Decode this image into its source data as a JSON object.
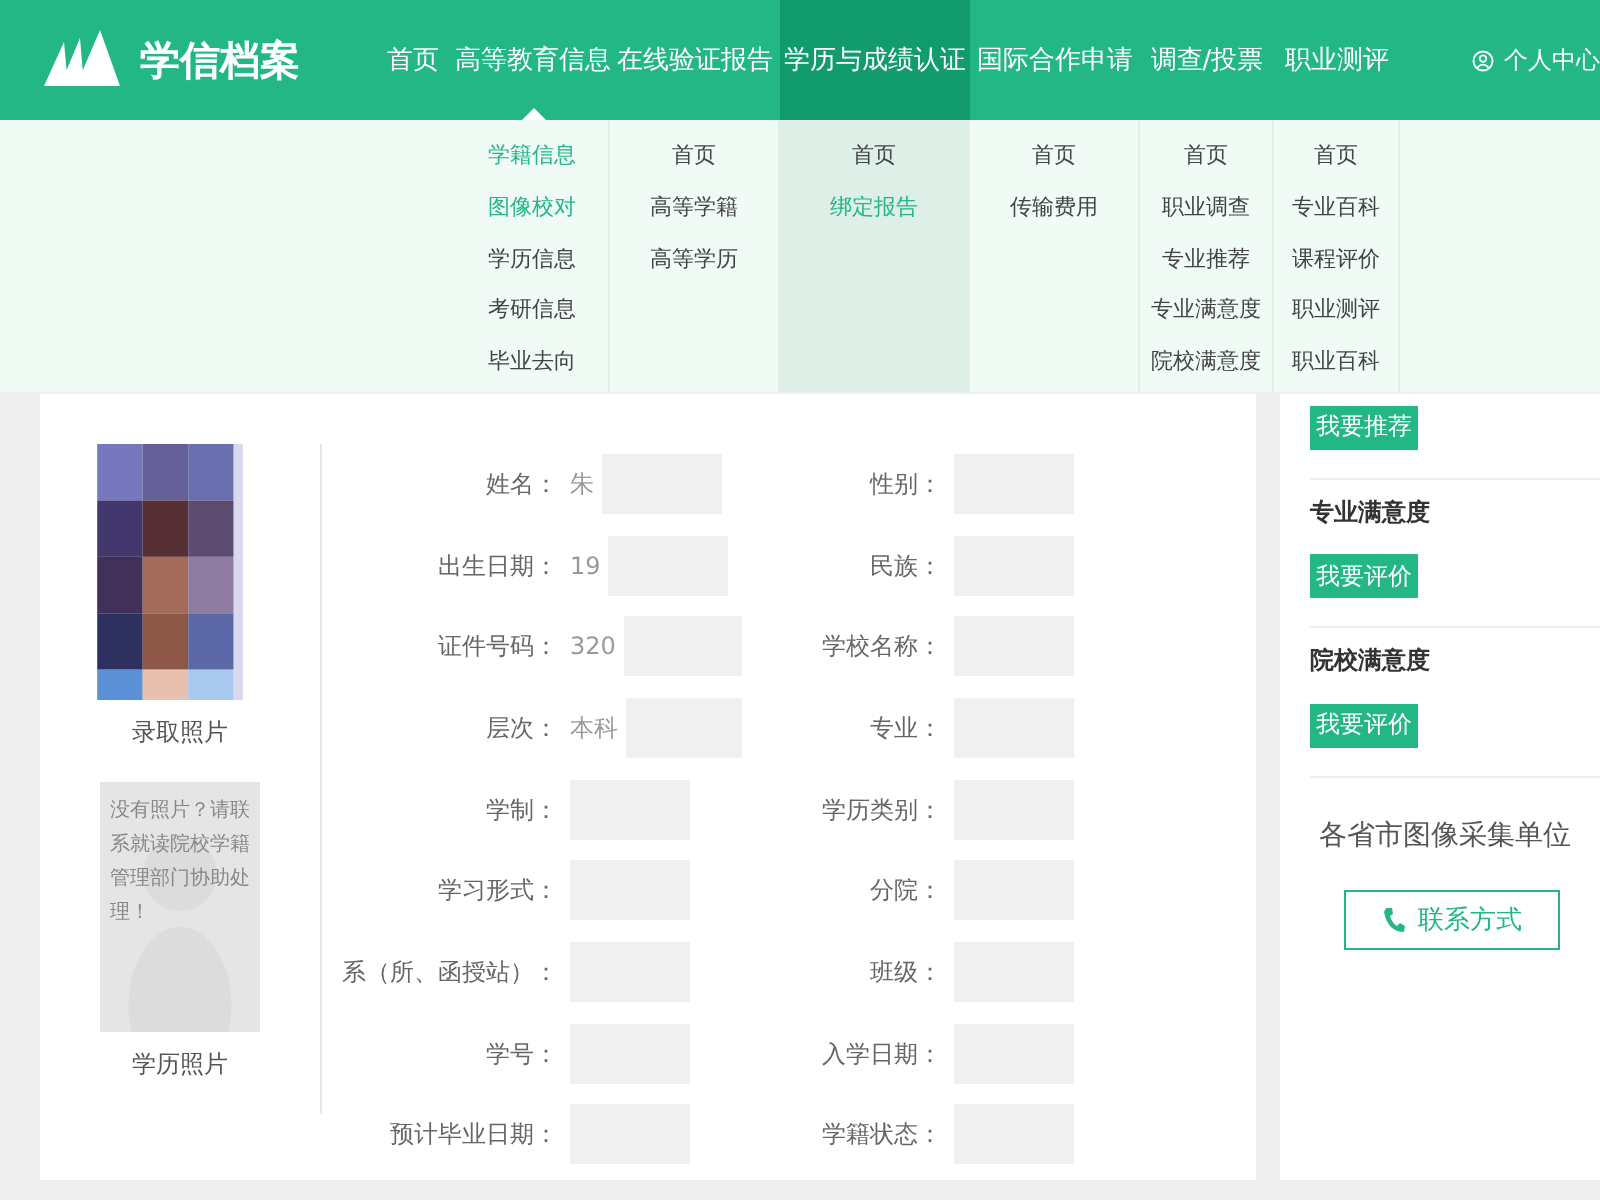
{
  "header": {
    "logo": "学信档案",
    "nav": [
      {
        "label": "首页",
        "selected": false,
        "expanded": false
      },
      {
        "label": "高等教育信息",
        "selected": false,
        "expanded": true
      },
      {
        "label": "在线验证报告",
        "selected": false,
        "expanded": false
      },
      {
        "label": "学历与成绩认证",
        "selected": true,
        "expanded": false
      },
      {
        "label": "国际合作申请",
        "selected": false,
        "expanded": false
      },
      {
        "label": "调查/投票",
        "selected": false,
        "expanded": false
      },
      {
        "label": "职业测评",
        "selected": false,
        "expanded": false
      }
    ],
    "user_link": "个人中心"
  },
  "dropdown": [
    {
      "items": [
        {
          "label": "学籍信息",
          "selected": true
        },
        {
          "label": "图像校对",
          "selected": true
        },
        {
          "label": "学历信息",
          "selected": false
        },
        {
          "label": "考研信息",
          "selected": false
        },
        {
          "label": "毕业去向",
          "selected": false
        }
      ]
    },
    {
      "items": [
        {
          "label": "首页",
          "selected": false
        },
        {
          "label": "高等学籍",
          "selected": false
        },
        {
          "label": "高等学历",
          "selected": false
        }
      ]
    },
    {
      "items": [
        {
          "label": "首页",
          "selected": false
        },
        {
          "label": "绑定报告",
          "selected": true
        }
      ]
    },
    {
      "items": [
        {
          "label": "首页",
          "selected": false
        },
        {
          "label": "传输费用",
          "selected": false
        }
      ]
    },
    {
      "items": [
        {
          "label": "首页",
          "selected": false
        },
        {
          "label": "职业调查",
          "selected": false
        },
        {
          "label": "专业推荐",
          "selected": false
        },
        {
          "label": "专业满意度",
          "selected": false
        },
        {
          "label": "院校满意度",
          "selected": false
        }
      ]
    },
    {
      "items": [
        {
          "label": "首页",
          "selected": false
        },
        {
          "label": "专业百科",
          "selected": false
        },
        {
          "label": "课程评价",
          "selected": false
        },
        {
          "label": "职业测评",
          "selected": false
        },
        {
          "label": "职业百科",
          "selected": false
        }
      ]
    }
  ],
  "photos": {
    "admission_label": "录取照片",
    "placeholder_text": "没有照片？请联系就读院校学籍管理部门协助处理！",
    "degree_label": "学历照片"
  },
  "fields": [
    {
      "label": "姓名：",
      "value": "朱"
    },
    {
      "label": "性别："
    },
    {
      "label": "出生日期：",
      "value": "19"
    },
    {
      "label": "民族："
    },
    {
      "label": "证件号码：",
      "value": "320"
    },
    {
      "label": "学校名称："
    },
    {
      "label": "层次：",
      "value": "本科"
    },
    {
      "label": "专业："
    },
    {
      "label": "学制："
    },
    {
      "label": "学历类别："
    },
    {
      "label": "学习形式："
    },
    {
      "label": "分院："
    },
    {
      "label": "系（所、函授站）："
    },
    {
      "label": "班级："
    },
    {
      "label": "学号："
    },
    {
      "label": "入学日期："
    },
    {
      "label": "预计毕业日期："
    },
    {
      "label": "学籍状态："
    }
  ],
  "sidebar": {
    "sections": [
      {
        "button": "我要推荐"
      },
      {
        "title": "专业满意度",
        "button": "我要评价"
      },
      {
        "title": "院校满意度",
        "button": "我要评价"
      }
    ],
    "collection_title": "各省市图像采集单位",
    "contact_button": "联系方式"
  }
}
